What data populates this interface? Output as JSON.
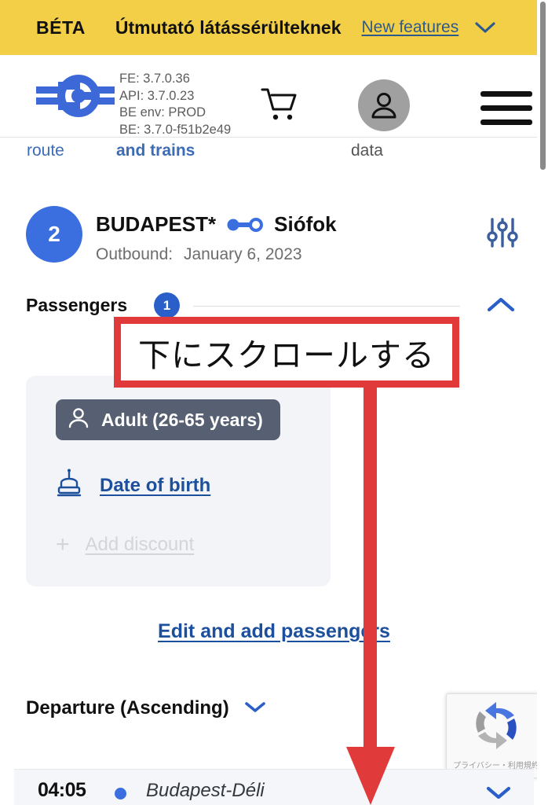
{
  "beta_bar": {
    "tag": "BÉTA",
    "guide_label": "Útmutató látássérülteknek",
    "new_features_label": "New features",
    "chevron_icon": "chevron-down-icon",
    "background_color": "#f3cf47"
  },
  "header": {
    "logo_icon": "mav-winged-wheel-logo",
    "version_lines": [
      "FE: 3.7.0.36",
      "API: 3.7.0.23",
      "BE env: PROD",
      "BE: 3.7.0-f51b2e49"
    ],
    "cart_icon": "shopping-cart-icon",
    "avatar_icon": "user-avatar-icon",
    "menu_icon": "hamburger-menu-icon"
  },
  "breadcrumbs": {
    "items": [
      "route",
      "and trains",
      "data"
    ]
  },
  "route": {
    "step_number": "2",
    "from": "BUDAPEST*",
    "connector_icon": "route-connector-icon",
    "to": "Siófok",
    "direction_label": "Outbound:",
    "date": "January 6, 2023",
    "filter_icon": "sliders-filter-icon",
    "badge_color": "#3b6fe0"
  },
  "passengers": {
    "title": "Passengers",
    "count": "1",
    "collapse_icon": "chevron-up-icon",
    "card": {
      "type_chip": {
        "person_icon": "person-icon",
        "label": "Adult (26-65 years)",
        "background_color": "#576072"
      },
      "date_of_birth": {
        "cake_icon": "birthday-cake-icon",
        "label": "Date of birth"
      },
      "add_discount": {
        "plus_icon": "plus-icon",
        "label": "Add discount",
        "disabled": true
      }
    },
    "edit_link": "Edit and add passengers"
  },
  "sort": {
    "label": "Departure (Ascending)",
    "chevron_icon": "chevron-down-icon"
  },
  "result_row": {
    "time": "04:05",
    "station_dot_icon": "station-dot-icon",
    "station": "Budapest-Déli",
    "expand_icon": "chevron-down-icon"
  },
  "recaptcha": {
    "logo_icon": "recaptcha-icon",
    "text": "プライバシー・利用規約"
  },
  "annotation": {
    "text": "下にスクロールする",
    "arrow_icon": "down-arrow-icon",
    "color": "#e03a3a"
  },
  "scrollbar": {
    "name": "vertical-scrollbar"
  }
}
